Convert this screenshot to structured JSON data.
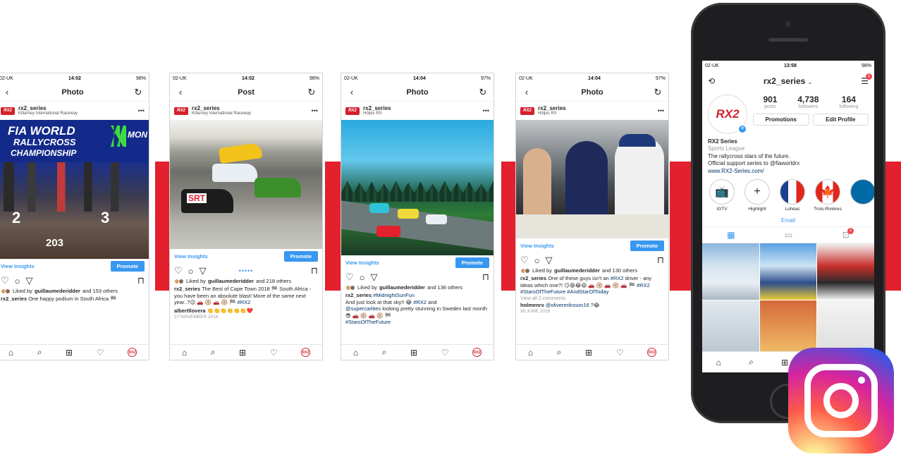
{
  "status_bar": {
    "carrier": "02-UK",
    "battery_s1": "98%",
    "battery_s3": "97%",
    "time_s1": "14:02",
    "time_s3": "14:04",
    "time_phone": "13:58"
  },
  "shots": [
    {
      "title": "Photo",
      "user": "rx2_series",
      "location": "Killarney International Raceway",
      "photo_text": [
        "FIA WORLD",
        "RALLYCROSS",
        "CHAMPIONSHIP",
        "MON",
        "203"
      ],
      "view_insights": "View Insights",
      "promote": "Promote",
      "likes_prefix": "Liked by",
      "likes_user": "guillaumederidder",
      "likes_suffix": "and 153 others",
      "caption_user": "rx2_series",
      "caption": "One happy podium in South Africa"
    },
    {
      "title": "Post",
      "user": "rx2_series",
      "location": "Killarney International Raceway",
      "photo_text": [
        "SRT"
      ],
      "view_insights": "View Insights",
      "promote": "Promote",
      "likes_prefix": "Liked by",
      "likes_user": "guillaumederidder",
      "likes_suffix": "and 218 others",
      "caption_user": "rx2_series",
      "caption": "The Best of Cape Town 2018 🏁 South Africa - you have been an absolute blast! More of the same next year..?😉 🚗 🛞 🚗 🛞 🏁",
      "caption_tag": "#RX2",
      "comment_user": "albertllovera",
      "comment_text": "👏👏👏👏👏👏❤️",
      "date": "27 NOVEMBER 2018"
    },
    {
      "title": "Photo",
      "user": "rx2_series",
      "location": "Höljes RX",
      "view_insights": "View Insights",
      "promote": "Promote",
      "likes_prefix": "Liked by",
      "likes_user": "guillaumederidder",
      "likes_suffix": "and 136 others",
      "caption_user": "rx2_series",
      "caption_tag": "#MidnightSunFun",
      "caption2": "And just look at that sky!! 😂",
      "caption2_tag": "#RX2",
      "caption3_tag": "@supercarlites",
      "caption3": "looking pretty stunning in Sweden last month 😎 🚗 🛞 🚗 🛞 🏁",
      "caption4_tag": "#StarsOfTheFuture"
    },
    {
      "title": "Photo",
      "user": "rx2_series",
      "location": "Höljes RX",
      "view_insights": "View Insights",
      "promote": "Promote",
      "likes_prefix": "Liked by",
      "likes_user": "guillaumederidder",
      "likes_suffix": "and 130 others",
      "caption_user": "rx2_series",
      "caption": "One of these guys isn't an",
      "caption_tag": "#RX2",
      "caption2": "driver - any ideas which one?! 😏😆😂😄 🚗 🛞 🚗 🛞 🚗 🏁",
      "caption3_tag": "#RX2 #StarsOfTheFuture #AndStarOfToday",
      "view_comments": "View all 2 comments",
      "comment_user": "holmenrx",
      "comment_tag": "@olivereriksson16",
      "comment_text": "?😂",
      "date": "30 JUNE 2018"
    }
  ],
  "profile": {
    "username": "rx2_series",
    "avatar_text": "RX2",
    "posts": "901",
    "posts_label": "posts",
    "followers": "4,738",
    "followers_label": "followers",
    "following": "164",
    "following_label": "following",
    "promotions": "Promotions",
    "edit_profile": "Edit Profile",
    "name": "RX2 Series",
    "category": "Sports League",
    "bio1": "The rallycross stars of the future.",
    "bio2": "Official support series to @fiaworldrx",
    "website": "www.RX2-Series.com/",
    "highlights": [
      "IGTV",
      "Highlight",
      "Lohéac",
      "Trois-Rivières"
    ],
    "email": "Email",
    "notif": "1"
  },
  "colors": {
    "accent_red": "#e3202e",
    "ig_blue": "#3897f0"
  }
}
